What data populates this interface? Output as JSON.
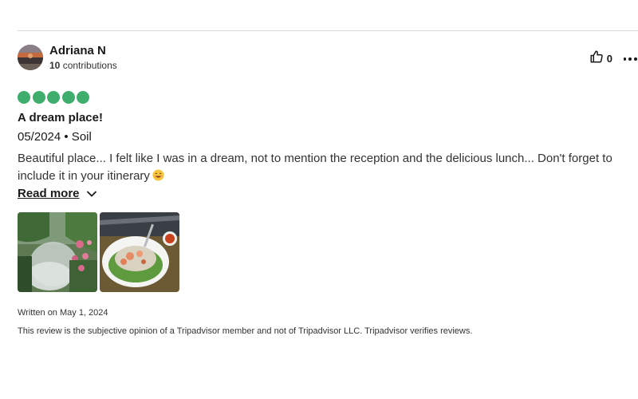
{
  "review": {
    "user": {
      "name": "Adriana N",
      "contributions_count": "10",
      "contributions_label": "contributions"
    },
    "helpful": {
      "icon": "thumbs-up-icon",
      "count": "0"
    },
    "more_icon": "more-dots-icon",
    "rating": {
      "value": 5,
      "max": 5,
      "color": "#3fae6d"
    },
    "title": "A dream place!",
    "meta": "05/2024 • Soil",
    "body": "Beautiful place... I felt like I was in a dream, not to mention the reception and the delicious lunch... Don't forget to include it in your itinerary",
    "emoji": "smiling-face-icon",
    "read_more_label": "Read more",
    "photos": [
      {
        "subject": "misty garden with pink flowers"
      },
      {
        "subject": "plate of shrimp salad with sauce"
      }
    ],
    "written_on": "Written on May 1, 2024",
    "disclaimer": "This review is the subjective opinion of a Tripadvisor member and not of Tripadvisor LLC. Tripadvisor verifies reviews."
  }
}
